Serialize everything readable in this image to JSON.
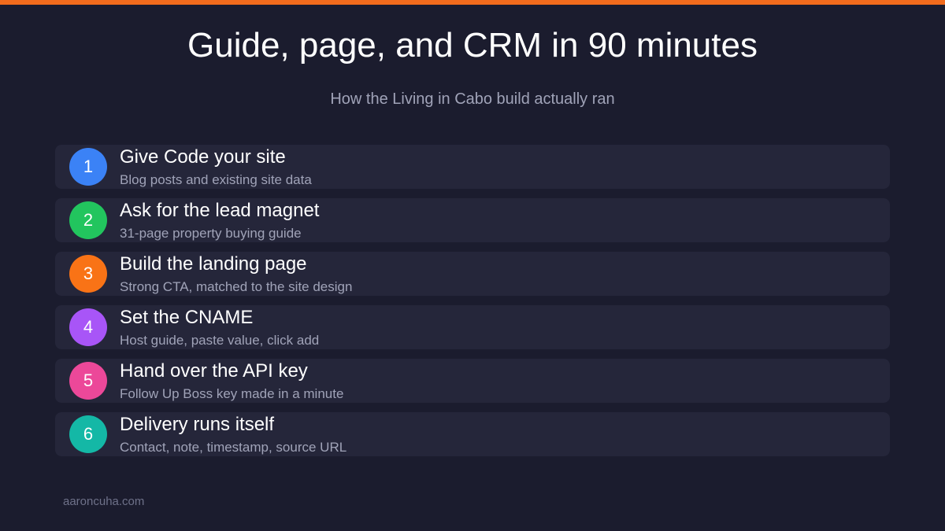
{
  "header": {
    "title": "Guide, page, and CRM in 90 minutes",
    "subtitle": "How the Living in Cabo build actually ran"
  },
  "steps": [
    {
      "number": "1",
      "title": "Give Code your site",
      "description": "Blog posts and existing site data",
      "color": "#3b82f6"
    },
    {
      "number": "2",
      "title": "Ask for the lead magnet",
      "description": "31-page property buying guide",
      "color": "#22c55e"
    },
    {
      "number": "3",
      "title": "Build the landing page",
      "description": "Strong CTA, matched to the site design",
      "color": "#f97316"
    },
    {
      "number": "4",
      "title": "Set the CNAME",
      "description": "Host guide, paste value, click add",
      "color": "#a855f7"
    },
    {
      "number": "5",
      "title": "Hand over the API key",
      "description": "Follow Up Boss key made in a minute",
      "color": "#ec4899"
    },
    {
      "number": "6",
      "title": "Delivery runs itself",
      "description": "Contact, note, timestamp, source URL",
      "color": "#14b8a6"
    }
  ],
  "footer": {
    "text": "aaroncuha.com"
  },
  "theme": {
    "accent": "#f26b1d",
    "background": "#1b1c2e",
    "card": "#25263a"
  }
}
